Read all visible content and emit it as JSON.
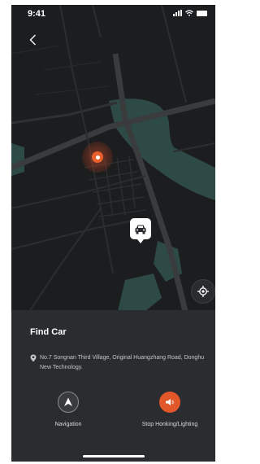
{
  "status_bar": {
    "time": "9:41"
  },
  "map": {
    "colors": {
      "background": "#1c1d1f",
      "road": "#3a3b3d",
      "water": "#2e4a47",
      "accent": "#e9602f"
    }
  },
  "panel": {
    "title": "Find Car",
    "address": "No.7 Songnan Third Village, Original Huangzhang Road, Donghu New Technology.",
    "actions": {
      "navigation_label": "Navigation",
      "honk_label": "Stop Honking/Lighting"
    }
  },
  "icons": {
    "back": "chevron-left-icon",
    "location": "location-pin-icon",
    "car": "car-icon",
    "locate": "locate-crosshair-icon",
    "address": "map-pin-icon",
    "navigation": "navigation-arrow-icon",
    "honk": "horn-icon"
  }
}
